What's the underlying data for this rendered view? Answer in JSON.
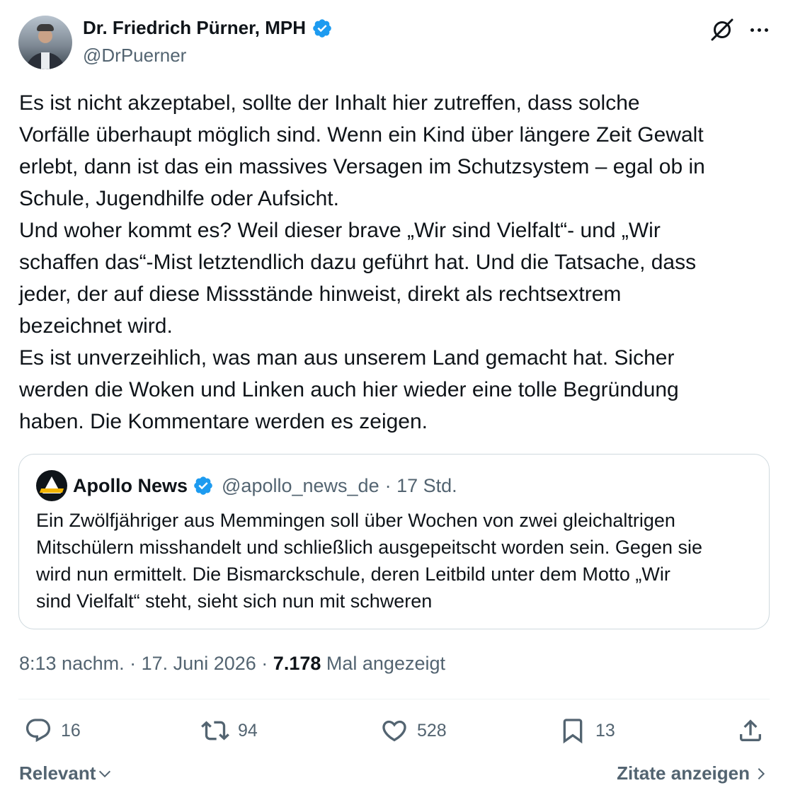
{
  "author": {
    "name": "Dr. Friedrich Pürner, MPH",
    "handle": "@DrPuerner",
    "verified": true
  },
  "tweet": {
    "lines": [
      "Es ist nicht akzeptabel, sollte der Inhalt hier zutreffen, dass solche",
      "Vorfälle überhaupt möglich sind. Wenn ein Kind über längere Zeit Gewalt",
      "erlebt, dann ist das ein massives Versagen im Schutzsystem – egal ob in",
      "Schule, Jugendhilfe oder Aufsicht.",
      "Und woher kommt es? Weil dieser brave „Wir sind Vielfalt“- und „Wir",
      "schaffen das“-Mist letztendlich dazu geführt hat. Und die Tatsache, dass",
      "jeder, der auf diese Missstände hinweist, direkt als rechtsextrem",
      "bezeichnet wird.",
      "Es ist unverzeihlich, was man aus unserem Land gemacht hat. Sicher",
      "werden die Woken und Linken auch hier wieder eine tolle Begründung",
      "haben. Die Kommentare werden es zeigen."
    ]
  },
  "quote": {
    "name": "Apollo News",
    "handle": "@apollo_news_de",
    "time": "· 17 Std.",
    "verified": true,
    "lines": [
      "Ein Zwölfjähriger aus Memmingen soll über Wochen von zwei gleichaltrigen",
      "Mitschülern misshandelt und schließlich ausgepeitscht worden sein. Gegen sie",
      "wird nun ermittelt. Die Bismarckschule, deren Leitbild unter dem Motto „Wir",
      "sind Vielfalt“ steht, sieht sich nun mit schweren"
    ]
  },
  "meta": {
    "time": "8:13 nachm.",
    "separator1": "·",
    "date": "17. Juni 2026",
    "separator2": "·",
    "views": "7.178",
    "views_label": "Mal angezeigt"
  },
  "actions": {
    "replies": "16",
    "reposts": "94",
    "likes": "528",
    "bookmarks": "13"
  },
  "footer": {
    "sort_label": "Relevant",
    "quotes_label": "Zitate anzeigen"
  },
  "colors": {
    "verified": "#1d9bf0",
    "text": "#0f1419",
    "secondary": "#536471",
    "border": "#cfd9de"
  },
  "icons": [
    "verified-badge-icon",
    "grok-icon",
    "more-icon",
    "reply-icon",
    "repost-icon",
    "like-icon",
    "bookmark-icon",
    "share-icon",
    "chevron-down-icon",
    "chevron-right-icon"
  ]
}
